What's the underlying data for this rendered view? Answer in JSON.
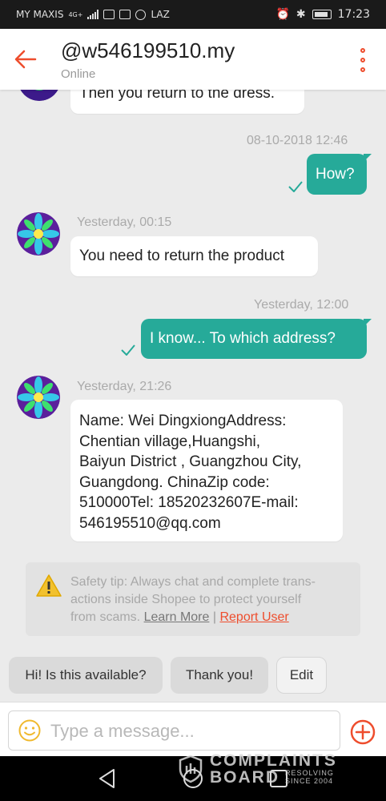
{
  "status_bar": {
    "carrier": "MY MAXIS",
    "network": "4G+",
    "app_label": "LAZ",
    "time": "17:23"
  },
  "header": {
    "title": "@w546199510.my",
    "subtitle": "Online"
  },
  "messages": [
    {
      "dir": "in",
      "text": "Then you return to the dress."
    },
    {
      "dir": "out",
      "timestamp": "08-10-2018 12:46",
      "text": "How?"
    },
    {
      "dir": "in",
      "timestamp": "Yesterday, 00:15",
      "text": "You need to return the product"
    },
    {
      "dir": "out",
      "timestamp": "Yesterday, 12:00",
      "text": "I know... To which address?"
    },
    {
      "dir": "in",
      "timestamp": "Yesterday, 21:26",
      "lines": [
        "Name: Wei DingxiongAddress:",
        "Chentian village,Huangshi,",
        "Baiyun District , Guangzhou City,",
        "Guangdong. ChinaZip code:",
        "510000Tel: 18520232607E-mail:",
        "546195510@qq.com"
      ]
    }
  ],
  "safety_tip": {
    "lines": [
      "Safety tip: Always chat and complete trans-",
      "actions inside Shopee to protect yourself"
    ],
    "line3": "from scams.",
    "learn_more": "Learn More",
    "separator": "|",
    "report_user": "Report User"
  },
  "quick_replies": [
    "Hi! Is this available?",
    "Thank you!",
    "Edit"
  ],
  "input": {
    "placeholder": "Type a message..."
  },
  "watermark": {
    "line1": "COMPLAINTS",
    "line2": "BOARD",
    "tag1": "RESOLVING",
    "tag2": "SINCE 2004"
  },
  "colors": {
    "accent": "#ee4d2d",
    "sent_bubble": "#26aa99"
  }
}
